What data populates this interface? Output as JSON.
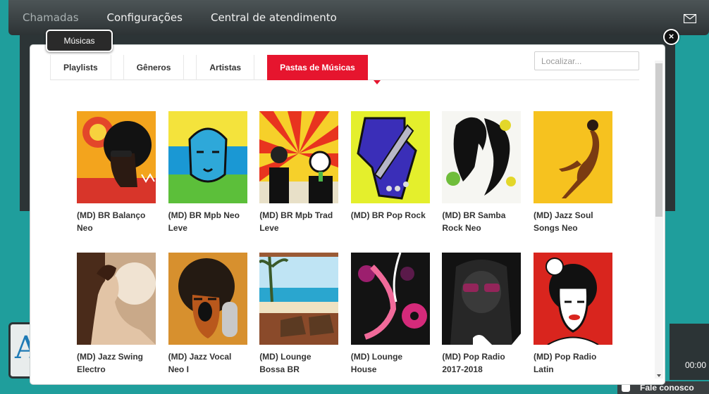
{
  "topbar": {
    "nav": [
      "Chamadas",
      "Configurações",
      "Central de atendimento"
    ],
    "mail_icon": "envelope-icon"
  },
  "background": {
    "time": "00:00",
    "fale": "Fale conosco"
  },
  "modal": {
    "tag": "Músicas",
    "close_label": "×",
    "tabs": [
      "Playlists",
      "Gêneros",
      "Artistas",
      "Pastas de Músicas"
    ],
    "active_tab": "Pastas de Músicas",
    "search_placeholder": "Localizar...",
    "colors": {
      "accent": "#e6152e",
      "bg": "#1f9e9c"
    }
  },
  "folders": [
    {
      "title": "(MD) BR Balanço Neo"
    },
    {
      "title": "(MD) BR Mpb Neo Leve"
    },
    {
      "title": "(MD) BR Mpb Trad Leve"
    },
    {
      "title": "(MD) BR Pop Rock"
    },
    {
      "title": "(MD) BR Samba Rock Neo"
    },
    {
      "title": "(MD) Jazz Soul Songs Neo"
    },
    {
      "title": "(MD) Jazz Swing Electro"
    },
    {
      "title": "(MD) Jazz Vocal Neo I"
    },
    {
      "title": "(MD) Lounge Bossa BR"
    },
    {
      "title": "(MD) Lounge House"
    },
    {
      "title": "(MD) Pop Radio 2017-2018",
      "selected": true
    },
    {
      "title": "(MD) Pop Radio Latin"
    }
  ]
}
